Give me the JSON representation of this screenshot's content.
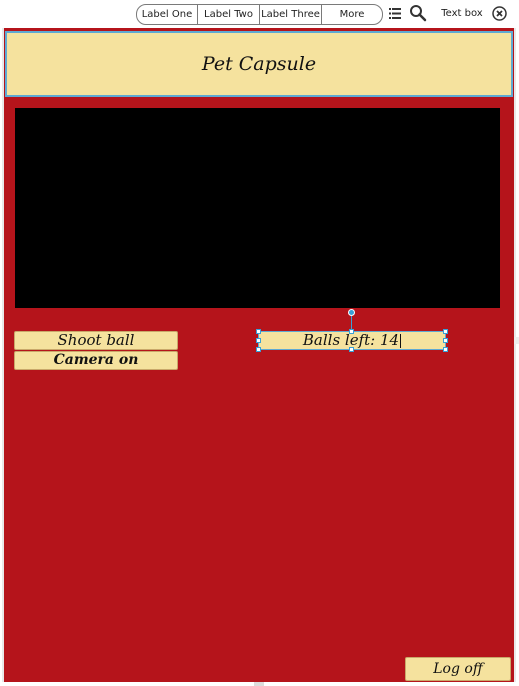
{
  "toolbar": {
    "segments": [
      "Label One",
      "Label Two",
      "Label Three",
      "More"
    ],
    "textbox": "Text box",
    "icons": {
      "list": "list-icon",
      "search": "search-icon",
      "close": "close-icon"
    }
  },
  "app": {
    "title": "Pet Capsule",
    "shoot_label": "Shoot ball",
    "camera_label": "Camera on",
    "balls_label": "Balls left: 14",
    "logoff_label": "Log off"
  },
  "colors": {
    "background": "#b5141b",
    "panel": "#f5e29e",
    "selection": "#39a0d6",
    "video": "#000000"
  }
}
